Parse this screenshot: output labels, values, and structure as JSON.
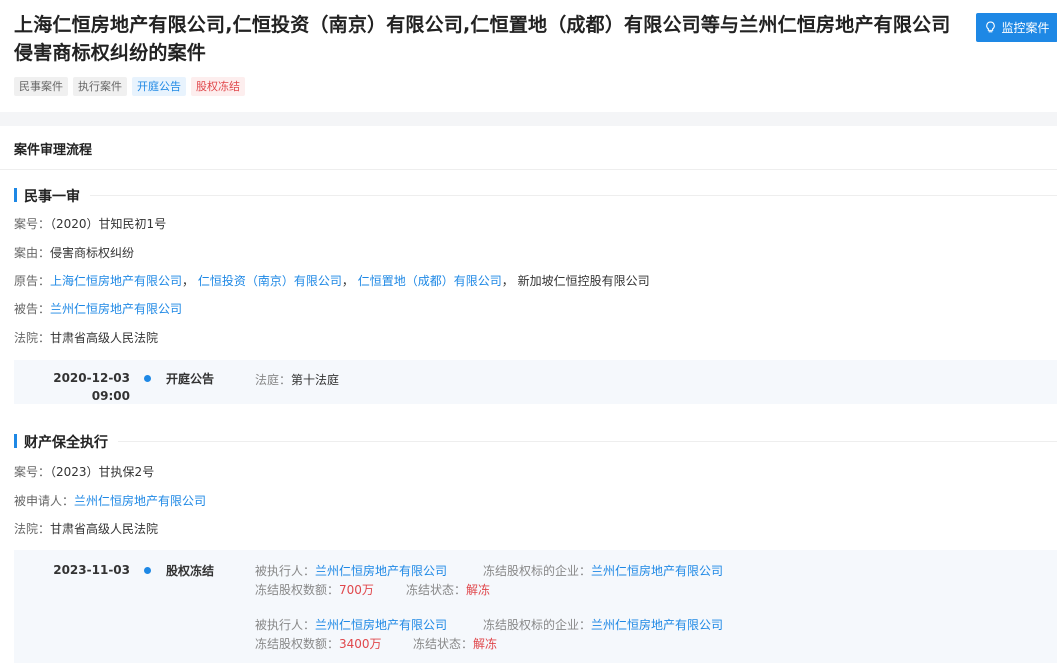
{
  "header": {
    "title": "上海仁恒房地产有限公司,仁恒投资（南京）有限公司,仁恒置地（成都）有限公司等与兰州仁恒房地产有限公司侵害商标权纠纷的案件",
    "monitor_label": "监控案件",
    "tags": [
      "民事案件",
      "执行案件",
      "开庭公告",
      "股权冻结"
    ]
  },
  "process": {
    "heading": "案件审理流程",
    "civil": {
      "title": "民事一审",
      "case_no_label": "案号：",
      "case_no": "（2020）甘知民初1号",
      "cause_label": "案由：",
      "cause": "侵害商标权纠纷",
      "plaintiff_label": "原告：",
      "plaintiffs": [
        "上海仁恒房地产有限公司",
        "仁恒投资（南京）有限公司",
        "仁恒置地（成都）有限公司"
      ],
      "plaintiff_sep": "，",
      "plaintiff_other": "新加坡仁恒控股有限公司",
      "defendant_label": "被告：",
      "defendant": "兰州仁恒房地产有限公司",
      "court_label": "法院：",
      "court": "甘肃省高级人民法院",
      "event": {
        "date": "2020-12-03",
        "time": "09:00",
        "type": "开庭公告",
        "detail_label": "法庭：",
        "detail": "第十法庭"
      }
    },
    "preservation": {
      "title": "财产保全执行",
      "case_no_label": "案号：",
      "case_no": "（2023）甘执保2号",
      "respondent_label": "被申请人：",
      "respondent": "兰州仁恒房地产有限公司",
      "court_label": "法院：",
      "court": "甘肃省高级人民法院",
      "event": {
        "date": "2023-11-03",
        "type": "股权冻结",
        "entries": [
          {
            "executed_label": "被执行人：",
            "executed": "兰州仁恒房地产有限公司",
            "target_label": "冻结股权标的企业：",
            "target": "兰州仁恒房地产有限公司",
            "amount_label": "冻结股权数额：",
            "amount": "700万",
            "status_label": "冻结状态：",
            "status": "解冻"
          },
          {
            "executed_label": "被执行人：",
            "executed": "兰州仁恒房地产有限公司",
            "target_label": "冻结股权标的企业：",
            "target": "兰州仁恒房地产有限公司",
            "amount_label": "冻结股权数额：",
            "amount": "3400万",
            "status_label": "冻结状态：",
            "status": "解冻"
          }
        ]
      }
    }
  },
  "colors": {
    "accent": "#1e88e5",
    "danger": "#e0474b"
  }
}
